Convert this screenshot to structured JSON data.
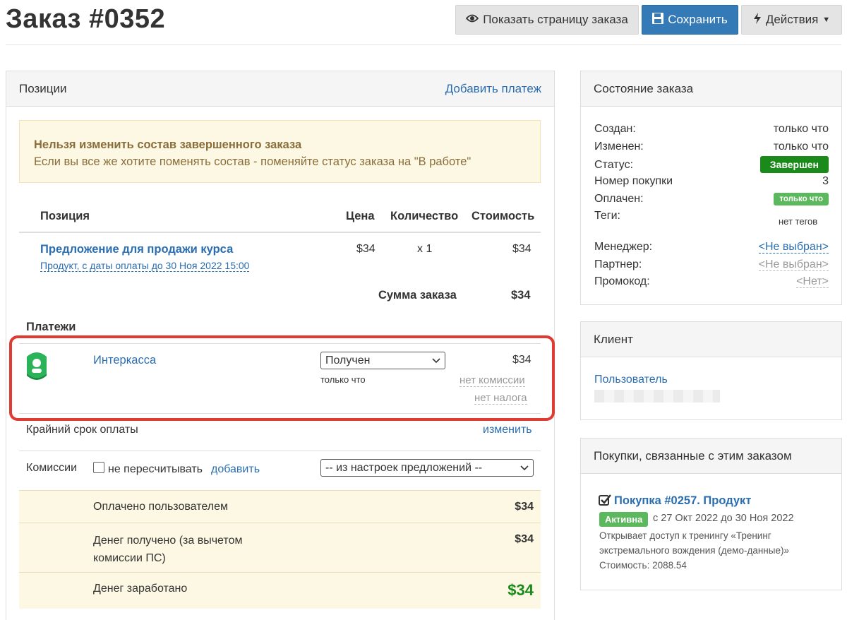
{
  "header": {
    "title": "Заказ #0352",
    "btn_show": "Показать страницу заказа",
    "btn_save": "Сохранить",
    "btn_actions": "Действия"
  },
  "positions": {
    "title": "Позиции",
    "add_payment": "Добавить платеж",
    "alert_title": "Нельзя изменить состав завершенного заказа",
    "alert_text": "Если вы все же хотите поменять состав - поменяйте статус заказа на \"В работе\"",
    "cols": [
      "Позиция",
      "Цена",
      "Количество",
      "Стоимость"
    ],
    "item": {
      "name": "Предложение для продажи курса",
      "sub": "Продукт, с даты оплаты до 30 Ноя 2022 15:00",
      "price": "$34",
      "qty": "x 1",
      "cost": "$34"
    },
    "sum_label": "Сумма заказа",
    "sum_value": "$34"
  },
  "payments": {
    "title": "Платежи",
    "name": "Интеркасса",
    "status": "Получен",
    "time": "только что",
    "amount": "$34",
    "no_commission": "нет комиссии",
    "no_tax": "нет налога"
  },
  "deadline": {
    "label": "Крайний срок оплаты",
    "action": "изменить"
  },
  "commissions": {
    "label": "Комиссии",
    "checkbox_label": "не пересчитывать",
    "add": "добавить",
    "select": "-- из настроек предложений --"
  },
  "totals": [
    {
      "label": "Оплачено пользователем",
      "value": "$34"
    },
    {
      "label": "Денег получено (за вычетом комиссии ПС)",
      "value": "$34"
    },
    {
      "label": "Денег заработано",
      "value": "$34"
    }
  ],
  "status_panel": {
    "title": "Состояние заказа",
    "created_label": "Создан:",
    "created": "только что",
    "changed_label": "Изменен:",
    "changed": "только что",
    "status_label": "Статус:",
    "status": "Завершен",
    "purchase_label": "Номер покупки",
    "purchase": "3",
    "paid_label": "Оплачен:",
    "paid": "только что",
    "tags_label": "Теги:",
    "tags": "нет тегов",
    "manager_label": "Менеджер:",
    "manager": "<Не выбран>",
    "partner_label": "Партнер:",
    "partner": "<Не выбран>",
    "promo_label": "Промокод:",
    "promo": "<Нет>"
  },
  "client": {
    "title": "Клиент",
    "user": "Пользователь"
  },
  "related": {
    "title": "Покупки, связанные с этим заказом",
    "link": "Покупка #0257. Продукт",
    "badge": "Активна",
    "dates": "с 27 Окт 2022 до 30 Ноя 2022",
    "desc1": "Открывает доступ к тренингу «Тренинг",
    "desc2": "экстремального вождения (демо-данные)»",
    "cost": "Стоимость: 2088.54"
  },
  "colors": {
    "accent": "#337ab7",
    "success": "#1a8a1a",
    "badge_light": "#5cb85c",
    "highlight": "#e03b32"
  }
}
